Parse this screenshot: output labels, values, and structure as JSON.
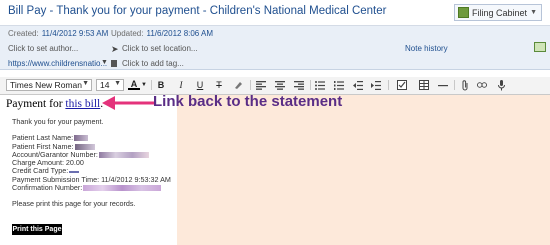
{
  "window": {
    "title": "Bill Pay - Thank you for your payment - Children's National Medical Center",
    "filing_button": "Filing Cabinet"
  },
  "meta": {
    "created_label": "Created:",
    "created_value": "11/4/2012 9:53 AM",
    "updated_label": "Updated:",
    "updated_value": "11/6/2012 8:06 AM",
    "author_placeholder": "Click to set author...",
    "location_placeholder": "Click to set location...",
    "note_history": "Note history",
    "url": "https://www.childrensnatio...",
    "tag_placeholder": "Click to add tag..."
  },
  "toolbar": {
    "font_family": "Times New Roman",
    "font_size": "14",
    "text_color_label": "A",
    "bold_label": "B",
    "italic_label": "I",
    "underline_label": "U",
    "strike_label": "T"
  },
  "content": {
    "payment_for_prefix": "Payment for ",
    "bill_link": "this bill",
    "payment_for_suffix": ".",
    "annotation": "Link back to the statement",
    "thank_you": "Thank you for your payment.",
    "patient_last_name": "Patient Last Name:",
    "patient_first_name": "Patient First Name:",
    "account_number": "Account/Garantor Number:",
    "charge_amount": "Charge Amount: 20.00",
    "credit_card_type": "Credit Card Type:",
    "submission_time": "Payment Submission Time: 11/4/2012 9:53:32 AM",
    "confirmation_number": "Confirmation Number:",
    "print_instruction": "Please print this page for your records.",
    "print_button": "Print this Page"
  },
  "colors": {
    "annotation": "#5a2d86",
    "arrow": "#e4327b",
    "peach_bg": "#fde9da",
    "meta_bg": "#e9eff7"
  }
}
